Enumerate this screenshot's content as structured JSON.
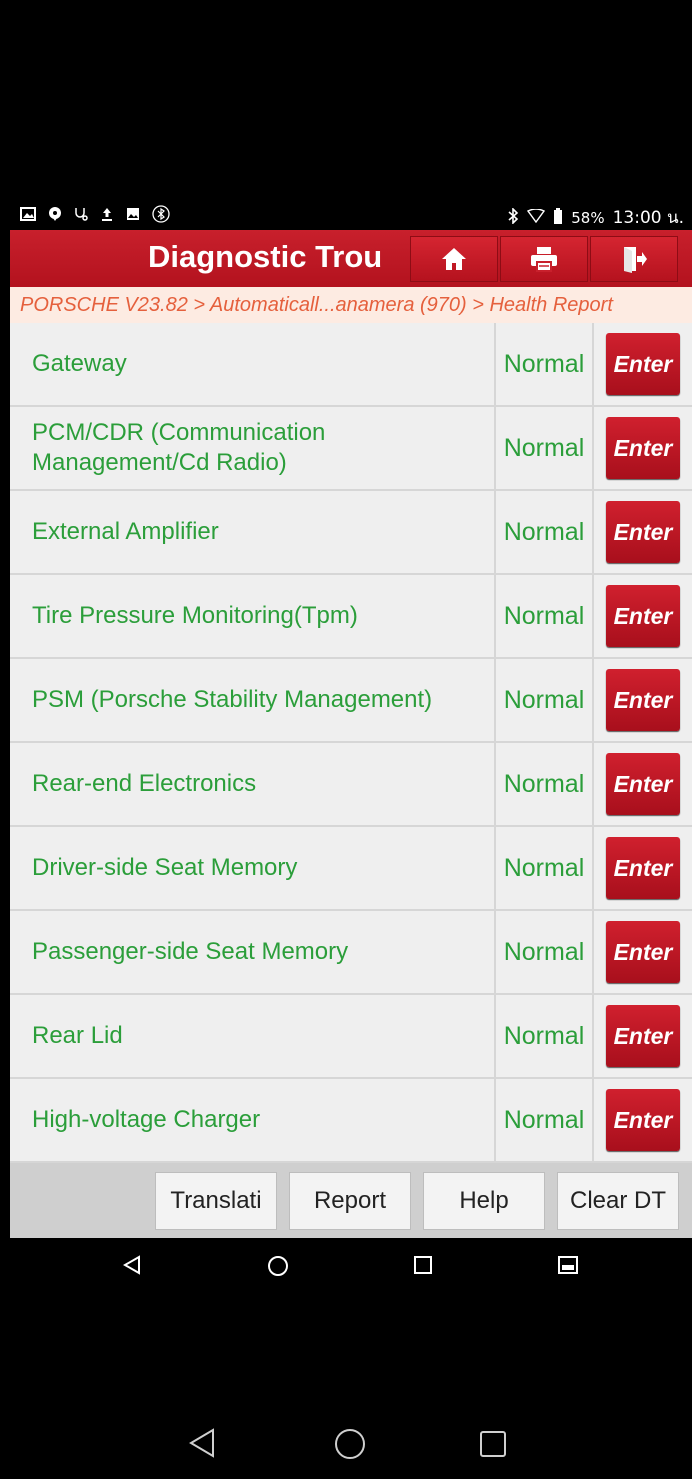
{
  "status_bar": {
    "battery_percent": "58%",
    "time": "13:00 น."
  },
  "header": {
    "title": "Diagnostic Trou"
  },
  "breadcrumb": "PORSCHE V23.82 > Automaticall...anamera (970) > Health Report",
  "rows": [
    {
      "name": "Gateway",
      "status": "Normal",
      "button": "Enter"
    },
    {
      "name": "PCM/CDR (Communication Management/Cd Radio)",
      "status": "Normal",
      "button": "Enter"
    },
    {
      "name": "External Amplifier",
      "status": "Normal",
      "button": "Enter"
    },
    {
      "name": "Tire Pressure Monitoring(Tpm)",
      "status": "Normal",
      "button": "Enter"
    },
    {
      "name": "PSM (Porsche Stability Management)",
      "status": "Normal",
      "button": "Enter"
    },
    {
      "name": "Rear-end Electronics",
      "status": "Normal",
      "button": "Enter"
    },
    {
      "name": "Driver-side Seat Memory",
      "status": "Normal",
      "button": "Enter"
    },
    {
      "name": "Passenger-side Seat Memory",
      "status": "Normal",
      "button": "Enter"
    },
    {
      "name": "Rear Lid",
      "status": "Normal",
      "button": "Enter"
    },
    {
      "name": "High-voltage Charger",
      "status": "Normal",
      "button": "Enter"
    }
  ],
  "bottom_bar": {
    "translate": "Translati",
    "report": "Report",
    "help": "Help",
    "clear": "Clear DT"
  },
  "colors": {
    "brand_red": "#c8202c",
    "status_green": "#2b9e3a",
    "breadcrumb_text": "#e5603d"
  }
}
